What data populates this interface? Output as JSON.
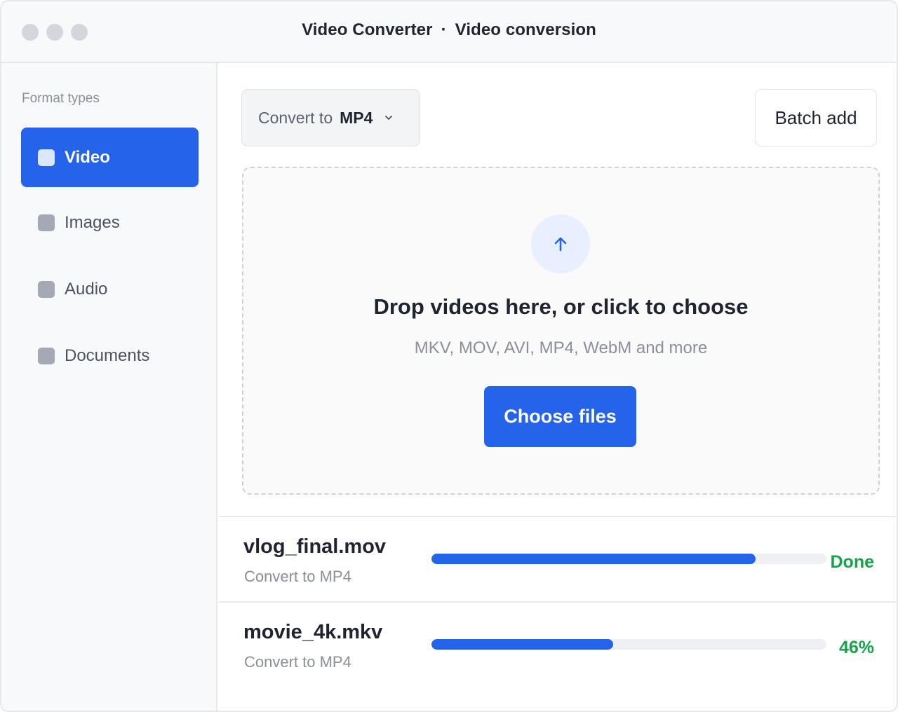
{
  "window": {
    "app_name": "Video Converter",
    "separator": "·",
    "page_name": "Video conversion"
  },
  "sidebar": {
    "heading": "Format types",
    "items": [
      {
        "label": "Video",
        "active": true
      },
      {
        "label": "Images",
        "active": false
      },
      {
        "label": "Audio",
        "active": false
      },
      {
        "label": "Documents",
        "active": false
      }
    ]
  },
  "toolbar": {
    "convert_prefix": "Convert to",
    "convert_value": "MP4",
    "batch_label": "Batch add"
  },
  "dropzone": {
    "title": "Drop videos here, or click to choose",
    "subtitle": "MKV, MOV, AVI, MP4, WebM and more",
    "button_label": "Choose files"
  },
  "files": [
    {
      "name": "vlog_final.mov",
      "target": "Convert to MP4",
      "progress": 0.82,
      "status": "Done"
    },
    {
      "name": "movie_4k.mkv",
      "target": "Convert to MP4",
      "progress": 0.46,
      "status": "46%"
    }
  ],
  "colors": {
    "accent": "#2563eb",
    "success": "#16a34a",
    "track": "#eff0f3"
  }
}
